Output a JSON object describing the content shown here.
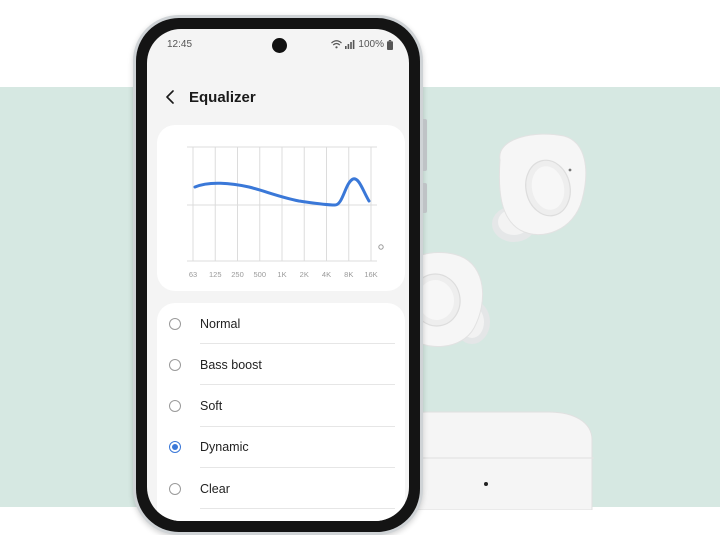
{
  "status_bar": {
    "time": "12:45",
    "battery": "100%"
  },
  "header": {
    "title": "Equalizer"
  },
  "equalizer": {
    "frequencies": [
      "63",
      "125",
      "250",
      "500",
      "1K",
      "2K",
      "4K",
      "8K",
      "16K"
    ],
    "curve_color": "#3a78d8"
  },
  "options": [
    {
      "label": "Normal",
      "selected": false
    },
    {
      "label": "Bass boost",
      "selected": false
    },
    {
      "label": "Soft",
      "selected": false
    },
    {
      "label": "Dynamic",
      "selected": true
    },
    {
      "label": "Clear",
      "selected": false
    }
  ],
  "colors": {
    "accent": "#3a78d8",
    "background": "#d6e8e2"
  }
}
